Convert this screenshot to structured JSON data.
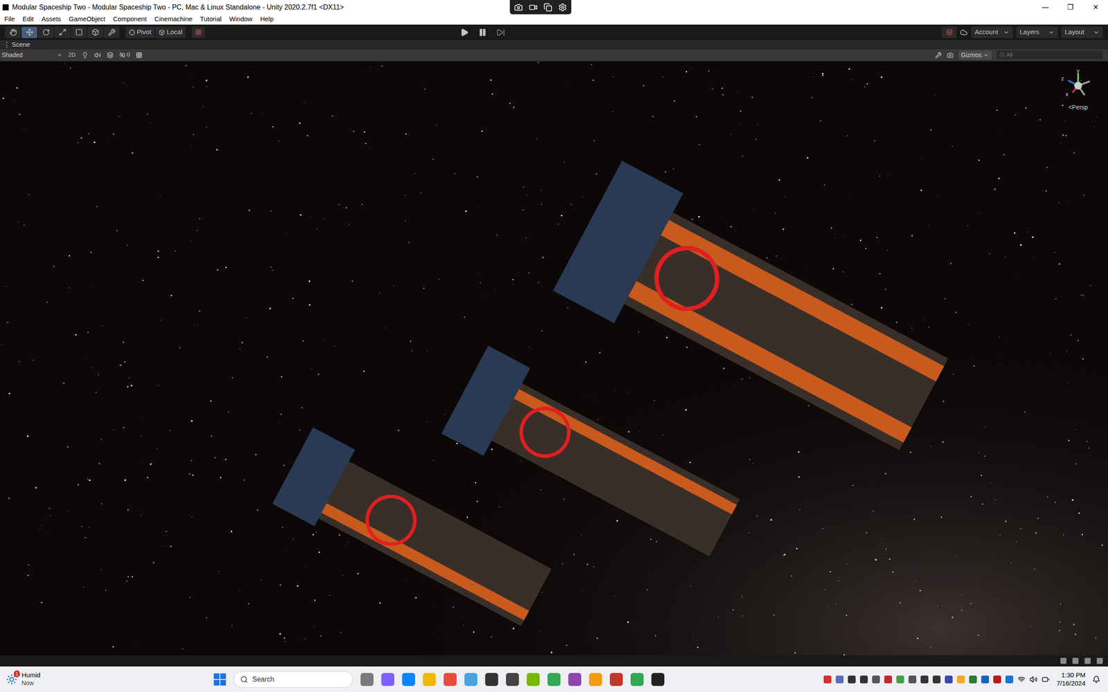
{
  "window": {
    "title": "Modular Spaceship Two - Modular Spaceship Two - PC, Mac & Linux Standalone - Unity 2020.2.7f1 <DX11>",
    "controls": [
      "—",
      "❐",
      "✕"
    ]
  },
  "menu": [
    "File",
    "Edit",
    "Assets",
    "GameObject",
    "Component",
    "Cinemachine",
    "Tutorial",
    "Window",
    "Help"
  ],
  "toolbar": {
    "tools": [
      {
        "name": "hand",
        "selected": false
      },
      {
        "name": "move",
        "selected": true
      },
      {
        "name": "rotate",
        "selected": false
      },
      {
        "name": "scale",
        "selected": false
      },
      {
        "name": "rect",
        "selected": false
      },
      {
        "name": "transform",
        "selected": false
      },
      {
        "name": "custom",
        "selected": false
      }
    ],
    "pivot": "Pivot",
    "space": "Local",
    "account": "Account",
    "layers": "Layers",
    "layout": "Layout"
  },
  "scene_tab": {
    "label": "Scene"
  },
  "scene_toolbar": {
    "shading": "Shaded",
    "mode_2d": "2D",
    "hidden_count": "0",
    "gizmos": "Gizmos",
    "search_placeholder": "All"
  },
  "gizmo": {
    "axes": [
      "y",
      "z",
      "x"
    ],
    "projection": "<Persp"
  },
  "taskbar": {
    "weather": {
      "badge": "1",
      "condition": "Humid",
      "time": "Now"
    },
    "search": "Search",
    "clock": {
      "time": "1:30 PM",
      "date": "7/16/2024"
    }
  }
}
